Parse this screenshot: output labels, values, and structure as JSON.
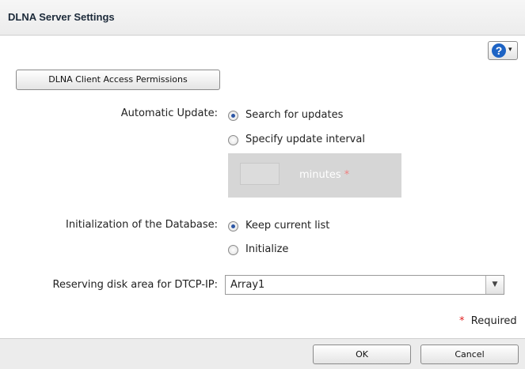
{
  "dialog": {
    "title": "DLNA Server Settings"
  },
  "help": {
    "glyph": "?",
    "caret": "▾",
    "icon": "help-icon"
  },
  "client_access_button": "DLNA Client Access Permissions",
  "automatic_update": {
    "label": "Automatic Update:",
    "options": [
      "Search for updates",
      "Specify update interval"
    ],
    "selected": "Search for updates",
    "interval_value": "",
    "interval_unit": "minutes",
    "interval_required_mark": "*"
  },
  "initialization": {
    "label": "Initialization of the Database:",
    "options": [
      "Keep current list",
      "Initialize"
    ],
    "selected": "Keep current list"
  },
  "dtcp": {
    "label": "Reserving disk area for DTCP-IP:",
    "value": "Array1",
    "arrow": "▼"
  },
  "required_note": {
    "mark": "*",
    "text": "Required"
  },
  "footer": {
    "ok_label": "OK",
    "cancel_label": "Cancel"
  },
  "colors": {
    "accent": "#1d63c4",
    "required": "#e02020"
  }
}
